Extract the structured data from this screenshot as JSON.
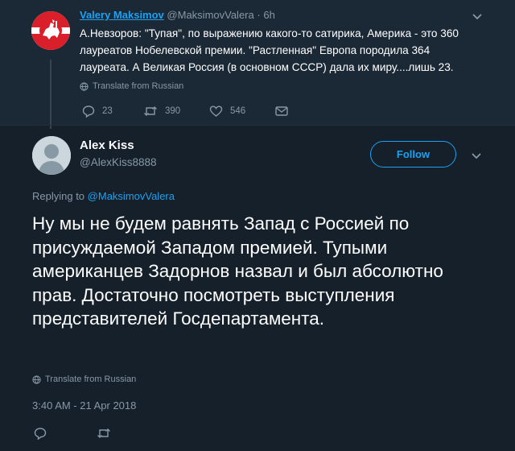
{
  "parent_tweet": {
    "author_name": "Valery Maksimov",
    "handle": "@MaksimovValera",
    "separator": "·",
    "time": "6h",
    "text": "А.Невзоров: \"Тупая\", по выражению какого-то сатирика, Америка - это 360 лауреатов Нобелевской премии. \"Растленная\" Европа породила 364 лауреата. А Великая Россия (в основном СССР) дала их миру....лишь 23.",
    "translate_label": "Translate from Russian",
    "reply_count": "23",
    "retweet_count": "390",
    "like_count": "546",
    "avatar_icon": "white-horseman-on-red-flag",
    "colors": {
      "avatar_red": "#d9202a",
      "avatar_white": "#ffffff"
    }
  },
  "main_tweet": {
    "author_name": "Alex Kiss",
    "handle": "@AlexKiss8888",
    "follow_label": "Follow",
    "replying_prefix": "Replying to",
    "replying_mention": "@MaksimovValera",
    "text": "Ну мы не будем равнять Запад с Россией по присуждаемой Западом премией. Тупыми американцев Задорнов назвал и был абсолютно прав. Достаточно посмотреть выступления представителей Госдепартамента.",
    "translate_label": "Translate from Russian",
    "timestamp": "3:40 AM - 21 Apr 2018",
    "avatar_icon": "default-user-silhouette"
  },
  "theme": {
    "background": "#15202b",
    "parent_background": "#1b2836",
    "accent": "#1da1f2",
    "muted": "#8899a6",
    "text": "#ffffff"
  }
}
